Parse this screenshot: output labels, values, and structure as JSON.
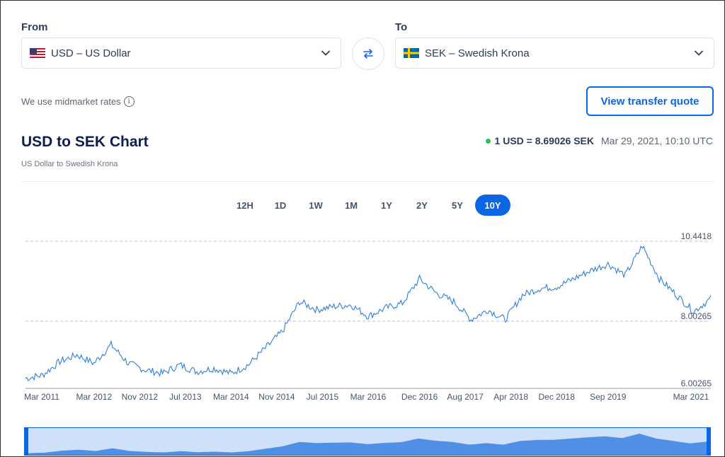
{
  "from": {
    "label": "From",
    "value": "USD – US Dollar",
    "flag_icon": "us-flag-icon"
  },
  "to": {
    "label": "To",
    "value": "SEK – Swedish Krona",
    "flag_icon": "se-flag-icon"
  },
  "rates_note": "We use midmarket rates",
  "quote_button": "View transfer quote",
  "chart_title": "USD to SEK Chart",
  "chart_subtitle": "US Dollar to Swedish Krona",
  "current_rate": "1 USD = 8.69026 SEK",
  "current_date": "Mar 29, 2021, 10:10 UTC",
  "ranges": [
    "12H",
    "1D",
    "1W",
    "1M",
    "1Y",
    "2Y",
    "5Y",
    "10Y"
  ],
  "active_range": "10Y",
  "colors": {
    "accent": "#0a66e3",
    "line": "#2f7fe0",
    "live_dot": "#2ebd59",
    "navigator_fill": "#4f8fe6",
    "navigator_bg": "#cfe1f8"
  },
  "chart_data": {
    "type": "line",
    "title": "USD to SEK Chart",
    "ylim": [
      6.00265,
      10.4418
    ],
    "y_ticks": [
      "10.4418",
      "8.00265",
      "6.00265"
    ],
    "x_ticks": [
      "Mar 2011",
      "Mar 2012",
      "Nov 2012",
      "Jul 2013",
      "Mar 2014",
      "Nov 2014",
      "Jul 2015",
      "Mar 2016",
      "Dec 2016",
      "Aug 2017",
      "Apr 2018",
      "Dec 2018",
      "Sep 2019",
      "Mar 2021"
    ],
    "series": [
      {
        "x": [
          "2011-03",
          "2011-06",
          "2011-09",
          "2011-12",
          "2012-03",
          "2012-06",
          "2012-09",
          "2012-12",
          "2013-03",
          "2013-06",
          "2013-09",
          "2013-12",
          "2014-03",
          "2014-06",
          "2014-09",
          "2014-12",
          "2015-03",
          "2015-06",
          "2015-09",
          "2015-12",
          "2016-03",
          "2016-06",
          "2016-09",
          "2016-12",
          "2017-03",
          "2017-06",
          "2017-09",
          "2017-12",
          "2018-03",
          "2018-06",
          "2018-09",
          "2018-12",
          "2019-03",
          "2019-06",
          "2019-09",
          "2019-12",
          "2020-03",
          "2020-06",
          "2020-09",
          "2020-12",
          "2021-03"
        ],
        "values": [
          6.3,
          6.4,
          6.8,
          7.0,
          6.75,
          7.3,
          6.75,
          6.55,
          6.45,
          6.7,
          6.5,
          6.6,
          6.45,
          6.7,
          7.2,
          7.7,
          8.6,
          8.35,
          8.45,
          8.5,
          8.15,
          8.4,
          8.55,
          9.3,
          8.85,
          8.6,
          8.05,
          8.35,
          8.05,
          8.8,
          9.0,
          9.05,
          9.3,
          9.55,
          9.75,
          9.4,
          10.3,
          9.3,
          8.8,
          8.3,
          8.69
        ]
      }
    ]
  }
}
